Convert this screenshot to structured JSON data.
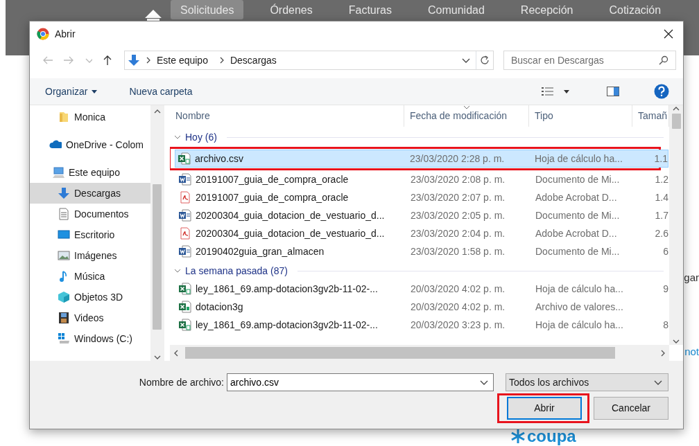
{
  "site": {
    "nav": [
      {
        "label": "Solicitudes",
        "selected": true
      },
      {
        "label": "Órdenes",
        "selected": false
      },
      {
        "label": "Facturas",
        "selected": false
      },
      {
        "label": "Comunidad",
        "selected": false
      },
      {
        "label": "Recepción",
        "selected": false
      },
      {
        "label": "Cotización",
        "selected": false
      }
    ],
    "side_fragments": [
      "gar",
      "not"
    ],
    "logo": "coupa"
  },
  "dialog": {
    "title": "Abrir",
    "address": {
      "path": [
        "Este equipo",
        "Descargas"
      ]
    },
    "search": {
      "placeholder": "Buscar en Descargas"
    },
    "toolbar": {
      "organize": "Organizar",
      "new_folder": "Nueva carpeta"
    },
    "sidebar": {
      "items": [
        {
          "label": "Monica",
          "kind": "folder",
          "selected": false
        },
        {
          "label": "OneDrive - Colom",
          "kind": "cloud",
          "selected": false
        },
        {
          "label": "Este equipo",
          "kind": "pc",
          "selected": false,
          "children": [
            {
              "label": "Descargas",
              "kind": "download",
              "selected": true
            },
            {
              "label": "Documentos",
              "kind": "document",
              "selected": false
            },
            {
              "label": "Escritorio",
              "kind": "desktop",
              "selected": false
            },
            {
              "label": "Imágenes",
              "kind": "images",
              "selected": false
            },
            {
              "label": "Música",
              "kind": "music",
              "selected": false
            },
            {
              "label": "Objetos 3D",
              "kind": "cube",
              "selected": false
            },
            {
              "label": "Videos",
              "kind": "video",
              "selected": false
            },
            {
              "label": "Windows (C:)",
              "kind": "drive",
              "selected": false
            }
          ]
        }
      ]
    },
    "files": {
      "columns": [
        {
          "label": "Nombre",
          "sorted": false
        },
        {
          "label": "Fecha de modificación",
          "sorted": true
        },
        {
          "label": "Tipo",
          "sorted": false
        },
        {
          "label": "Tamañ",
          "sorted": false
        }
      ],
      "groups": [
        {
          "label": "Hoy (6)",
          "expanded": true,
          "rows": [
            {
              "kind": "excel",
              "name": "archivo.csv",
              "date": "23/03/2020 2:28 p. m.",
              "type": "Hoja de cálculo ha...",
              "size": "1.1",
              "selected": true,
              "highlighted": true
            },
            {
              "kind": "word",
              "name": "20191007_guia_de_compra_oracle",
              "date": "23/03/2020 2:08 p. m.",
              "type": "Documento de Mi...",
              "size": "1.2",
              "selected": false,
              "highlighted": false
            },
            {
              "kind": "pdf",
              "name": "20191007_guia_de_compra_oracle",
              "date": "23/03/2020 2:07 p. m.",
              "type": "Adobe Acrobat D...",
              "size": "1.4",
              "selected": false,
              "highlighted": false
            },
            {
              "kind": "word",
              "name": "20200304_guia_dotacion_de_vestuario_d...",
              "date": "23/03/2020 2:05 p. m.",
              "type": "Documento de Mi...",
              "size": "1.7",
              "selected": false,
              "highlighted": false
            },
            {
              "kind": "pdf",
              "name": "20200304_guia_dotacion_de_vestuario_d...",
              "date": "23/03/2020 2:04 p. m.",
              "type": "Adobe Acrobat D...",
              "size": "2.6",
              "selected": false,
              "highlighted": false
            },
            {
              "kind": "word",
              "name": "20190402guia_gran_almacen",
              "date": "23/03/2020 1:58 p. m.",
              "type": "Documento de Mi...",
              "size": "6",
              "selected": false,
              "highlighted": false
            }
          ]
        },
        {
          "label": "La semana pasada (87)",
          "expanded": true,
          "rows": [
            {
              "kind": "excel",
              "name": "ley_1861_69.amp-dotacion3gv2b-11-02-...",
              "date": "20/03/2020 4:02 p. m.",
              "type": "Hoja de cálculo ha...",
              "size": "9",
              "selected": false,
              "highlighted": false
            },
            {
              "kind": "excel-csv",
              "name": "dotacion3g",
              "date": "20/03/2020 4:02 p. m.",
              "type": "Archivo de valores...",
              "size": "",
              "selected": false,
              "highlighted": false
            },
            {
              "kind": "excel",
              "name": "ley_1861_69.amp-dotacion3gv2b-11-02-...",
              "date": "20/03/2020 3:23 p. m.",
              "type": "Hoja de cálculo ha...",
              "size": "8",
              "selected": false,
              "highlighted": false
            }
          ]
        }
      ]
    },
    "filename": {
      "label": "Nombre de archivo:",
      "value": "archivo.csv"
    },
    "filter": "Todos los archivos",
    "buttons": [
      {
        "label": "Abrir",
        "default": true,
        "highlighted": true
      },
      {
        "label": "Cancelar",
        "default": false,
        "highlighted": false
      }
    ]
  }
}
